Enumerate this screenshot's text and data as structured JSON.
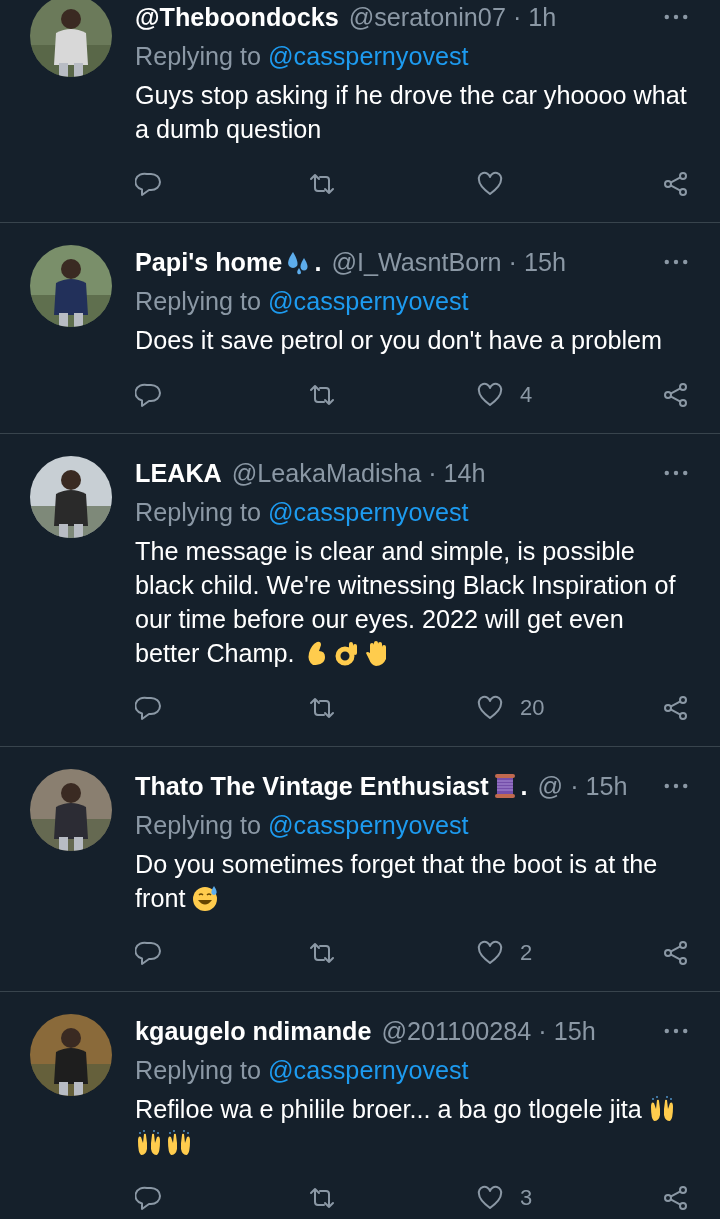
{
  "tweets": [
    {
      "name": [
        {
          "kind": "text",
          "text": "@Theboondocks"
        }
      ],
      "meta": "@seratonin07 · 1h",
      "replying_to": "Replying to",
      "mention": "@casspernyovest",
      "body": [
        [
          {
            "kind": "text",
            "text": "Guys stop asking if he drove the car yhoooo what a dumb question"
          }
        ]
      ]
    },
    {
      "name": [
        {
          "kind": "text",
          "text": "Papi's home"
        },
        {
          "kind": "droplets"
        },
        {
          "kind": "text",
          "text": "."
        }
      ],
      "meta": "@I_WasntBorn · 15h",
      "replying_to": "Replying to",
      "mention": "@casspernyovest",
      "body": [
        [
          {
            "kind": "text",
            "text": "Does it save petrol or you don't have a problem"
          }
        ]
      ],
      "like_count": "4"
    },
    {
      "name": [
        {
          "kind": "text",
          "text": "LEAKA"
        }
      ],
      "meta": "@LeakaMadisha · 14h",
      "replying_to": "Replying to",
      "mention": "@casspernyovest",
      "body": [
        [
          {
            "kind": "text",
            "text": "The message is clear and simple, is possible black child. We're witnessing Black Inspiration of our time before our eyes. 2022 will get even"
          }
        ],
        [
          {
            "kind": "text",
            "text": "better Champ."
          },
          {
            "kind": "pinch"
          },
          {
            "kind": "ok"
          },
          {
            "kind": "raised-hand"
          }
        ]
      ],
      "like_count": "20"
    },
    {
      "name": [
        {
          "kind": "text",
          "text": "Thato The Vintage Enthusiast"
        },
        {
          "kind": "spool"
        },
        {
          "kind": "text",
          "text": "."
        }
      ],
      "meta": "@ · 15h",
      "replying_to": "Replying to",
      "mention": "@casspernyovest",
      "body": [
        [
          {
            "kind": "text",
            "text": "Do you sometimes forget that the boot is at the"
          }
        ],
        [
          {
            "kind": "text",
            "text": "front"
          },
          {
            "kind": "sweat-smile"
          }
        ]
      ],
      "like_count": "2"
    },
    {
      "name": [
        {
          "kind": "text",
          "text": "kgaugelo ndimande"
        }
      ],
      "meta": "@201100284 · 15h",
      "replying_to": "Replying to",
      "mention": "@casspernyovest",
      "body": [
        [
          {
            "kind": "text",
            "text": "Refiloe wa e philile broer... a ba go tlogele jita"
          },
          {
            "kind": "raising-hands"
          }
        ],
        [
          {
            "kind": "raising-hands"
          },
          {
            "kind": "raising-hands"
          }
        ]
      ],
      "like_count": "3"
    }
  ]
}
